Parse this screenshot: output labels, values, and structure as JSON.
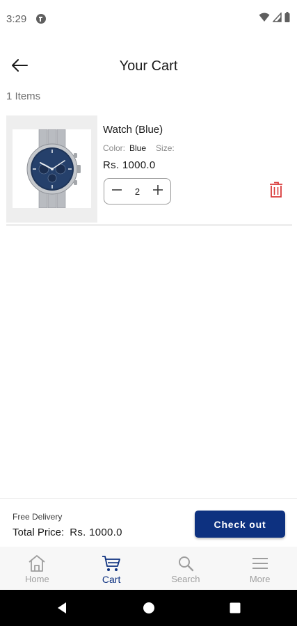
{
  "status_bar": {
    "time": "3:29"
  },
  "header": {
    "title": "Your Cart"
  },
  "cart": {
    "items_count": "1 Items",
    "items": [
      {
        "name": "Watch (Blue)",
        "color_label": "Color:",
        "color_value": "Blue",
        "size_label": "Size:",
        "price": "Rs. 1000.0",
        "quantity": "2"
      }
    ]
  },
  "checkout": {
    "delivery": "Free Delivery",
    "total_label": "Total Price:",
    "total_value": "Rs. 1000.0",
    "button_label": "Check out"
  },
  "bottom_nav": {
    "items": [
      {
        "label": "Home",
        "icon": "home-icon",
        "active": false
      },
      {
        "label": "Cart",
        "icon": "cart-icon",
        "active": true
      },
      {
        "label": "Search",
        "icon": "search-icon",
        "active": false
      },
      {
        "label": "More",
        "icon": "menu-icon",
        "active": false
      }
    ]
  },
  "colors": {
    "accent": "#0d3180",
    "delete": "#d93a3a",
    "inactive_nav": "#9e9e9e"
  }
}
